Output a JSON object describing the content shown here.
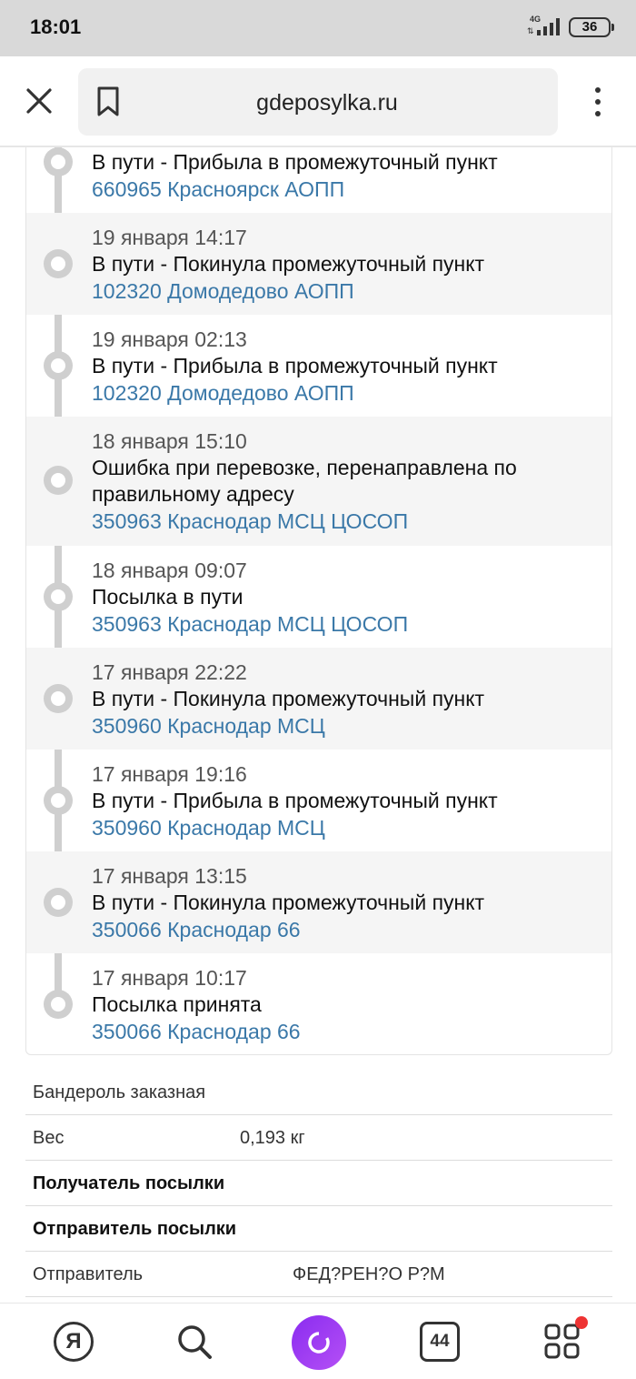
{
  "status_bar": {
    "time": "18:01",
    "network": "4G",
    "battery": "36"
  },
  "browser": {
    "url": "gdeposylka.ru"
  },
  "timeline": [
    {
      "date": "",
      "status": "В пути - Прибыла в промежуточный пункт",
      "place": "660965 Красноярск АОПП"
    },
    {
      "date": "19 января 14:17",
      "status": "В пути - Покинула промежуточный пункт",
      "place": "102320 Домодедово АОПП"
    },
    {
      "date": "19 января 02:13",
      "status": "В пути - Прибыла в промежуточный пункт",
      "place": "102320 Домодедово АОПП"
    },
    {
      "date": "18 января 15:10",
      "status": "Ошибка при перевозке, перенаправлена по правильному адресу",
      "place": "350963 Краснодар МСЦ ЦОСОП"
    },
    {
      "date": "18 января 09:07",
      "status": "Посылка в пути",
      "place": "350963 Краснодар МСЦ ЦОСОП"
    },
    {
      "date": "17 января 22:22",
      "status": "В пути - Покинула промежуточный пункт",
      "place": "350960 Краснодар МСЦ"
    },
    {
      "date": "17 января 19:16",
      "status": "В пути - Прибыла в промежуточный пункт",
      "place": "350960 Краснодар МСЦ"
    },
    {
      "date": "17 января 13:15",
      "status": "В пути - Покинула промежуточный пункт",
      "place": "350066 Краснодар 66"
    },
    {
      "date": "17 января 10:17",
      "status": "Посылка принята",
      "place": "350066 Краснодар 66"
    }
  ],
  "info": {
    "type": "Бандероль заказная",
    "weight_label": "Вес",
    "weight_value": "0,193 кг",
    "recipient_heading": "Получатель посылки",
    "sender_heading": "Отправитель посылки",
    "sender_label": "Отправитель",
    "sender_value": "ФЕД?РЕН?О Р?М"
  },
  "bottom_nav": {
    "tabs_count": "44",
    "yandex_letter": "Я"
  }
}
